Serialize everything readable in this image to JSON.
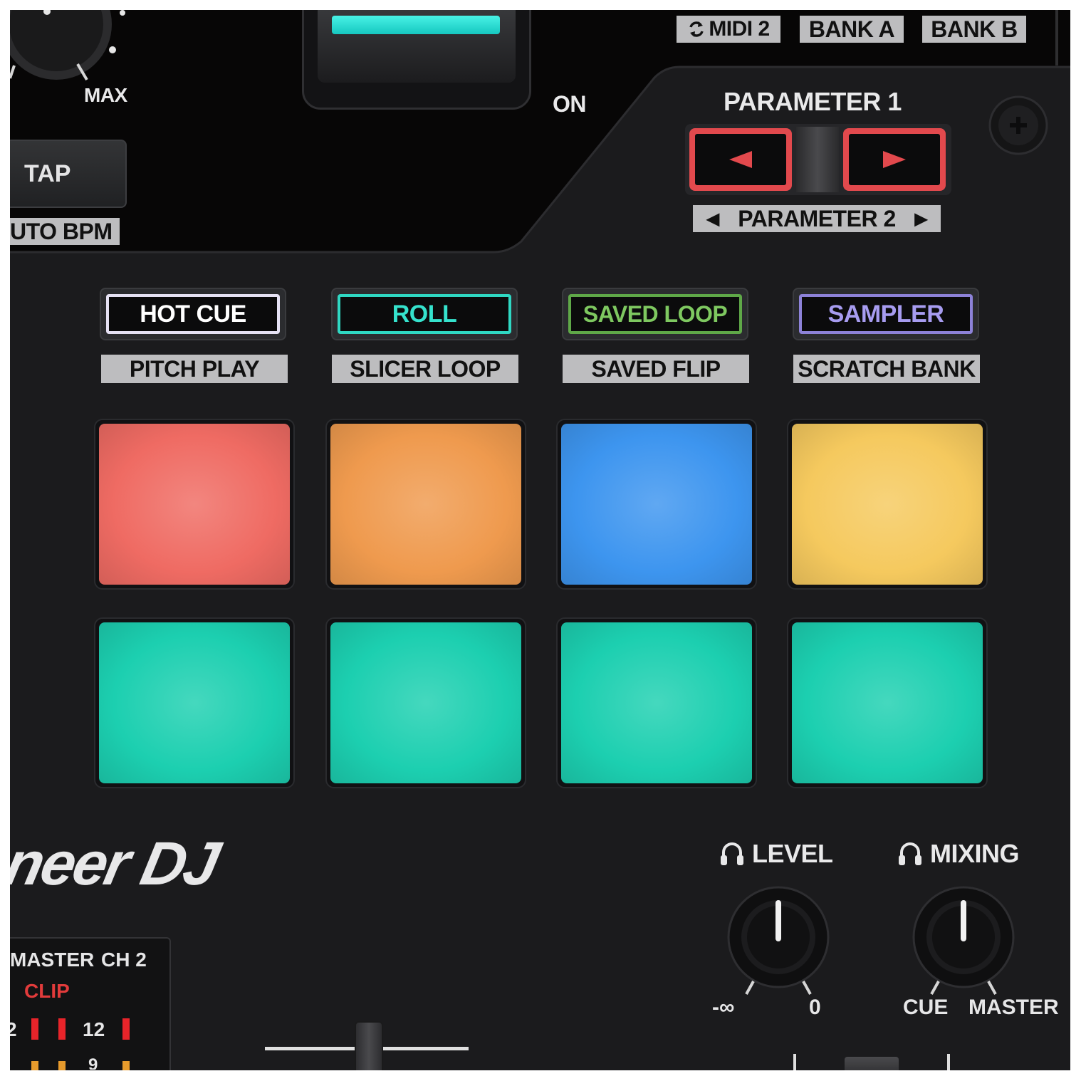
{
  "header": {
    "midi_label": "MIDI 2",
    "bank_a_label": "BANK A",
    "bank_b_label": "BANK B",
    "max_label": "MAX",
    "on_label": "ON",
    "tap_label": "TAP",
    "auto_bpm_label": "UTO BPM",
    "parameter1_label": "PARAMETER 1",
    "parameter2_label": "PARAMETER 2",
    "left_arrow": "◄",
    "right_arrow": "►"
  },
  "modes": [
    {
      "label": "HOT CUE",
      "sub": "PITCH PLAY",
      "color": "#e6e2f5"
    },
    {
      "label": "ROLL",
      "sub": "SLICER LOOP",
      "color": "#2fd8c3"
    },
    {
      "label": "SAVED LOOP",
      "sub": "SAVED FLIP",
      "color": "#63b24a"
    },
    {
      "label": "SAMPLER",
      "sub": "SCRATCH BANK",
      "color": "#8d82d8"
    }
  ],
  "pads": {
    "row1": [
      "#ef6b63",
      "#ef9a4e",
      "#3d95ef",
      "#f5c95e"
    ],
    "row2": [
      "#1ccfb0",
      "#1ccfb0",
      "#1ccfb0",
      "#1ccfb0"
    ]
  },
  "brand": {
    "logo_text": "neer DJ"
  },
  "headphones": {
    "level_label": "LEVEL",
    "mixing_label": "MIXING",
    "level_min": "-∞",
    "level_max": "0",
    "mixing_min": "CUE",
    "mixing_max": "MASTER"
  },
  "meter": {
    "master_label": "MASTER",
    "ch2_label": "CH 2",
    "clip_label": "CLIP",
    "level_12": "12",
    "left_fragment": "2",
    "bottom_fragment": "9"
  }
}
